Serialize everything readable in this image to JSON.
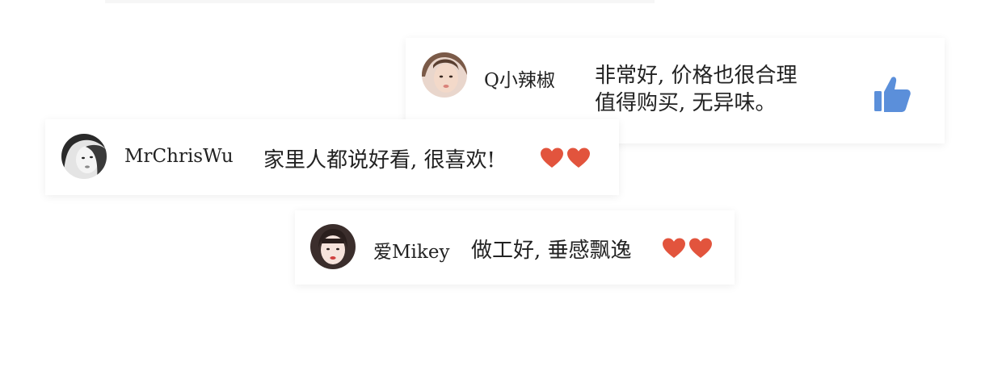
{
  "reviews": [
    {
      "username": "Q小辣椒",
      "comment_lines": [
        "非常好, 价格也很合理",
        "值得购买, 无异味。"
      ],
      "icon": "thumbs-up-icon"
    },
    {
      "username": "MrChrisWu",
      "comment": "家里人都说好看, 很喜欢!",
      "icon": "two-hearts-icon"
    },
    {
      "username": "爱Mikey",
      "comment": "做工好, 垂感飘逸",
      "icon": "two-hearts-icon"
    }
  ],
  "colors": {
    "heart": "#E2543D",
    "thumb": "#5B8FDA",
    "card_bg": "#FFFFFF"
  }
}
